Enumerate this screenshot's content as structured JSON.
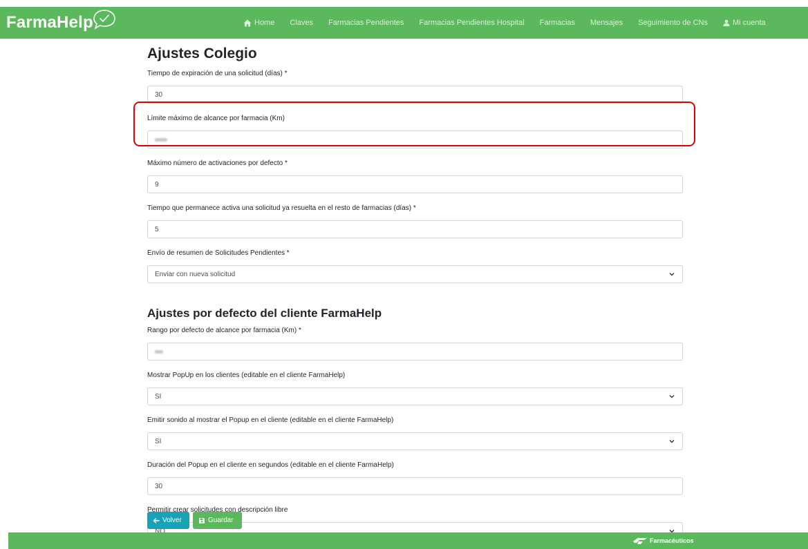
{
  "brand": {
    "name": "FarmaHelp"
  },
  "nav": {
    "home": "Home",
    "claves": "Claves",
    "farmacias_pendientes": "Farmacias Pendientes",
    "farmacias_pendientes_hospital": "Farmacias Pendientes Hospital",
    "farmacias": "Farmacias",
    "mensajes": "Mensajes",
    "seguimiento": "Seguimiento de CNs",
    "mi_cuenta": "Mi cuenta"
  },
  "colegio": {
    "title": "Ajustes Colegio",
    "expiracion_label": "Tiempo de expiración de una solicitud (días) *",
    "expiracion_value": "30",
    "alcance_label": "Límite máximo de alcance por farmacia (Km)",
    "activaciones_label": "Máximo número de activaciones por defecto *",
    "activaciones_value": "9",
    "permanece_label": "Tiempo que permanece activa una solicitud ya resuelta en el resto de farmacias (días) *",
    "permanece_value": "5",
    "resumen_label": "Envío de resumen de Solicitudes Pendientes *",
    "resumen_value": "Enviar con nueva solicitud"
  },
  "cliente": {
    "title": "Ajustes por defecto del cliente FarmaHelp",
    "rango_label": "Rango por defecto de alcance por farmacia (Km) *",
    "popup_label": "Mostrar PopUp en los clientes (editable en el cliente FarmaHelp)",
    "popup_value": "SI",
    "sonido_label": "Emitir sonido al mostrar el Popup en el cliente (editable en el cliente FarmaHelp)",
    "sonido_value": "SI",
    "duracion_label": "Duración del Popup en el cliente en segundos (editable en el cliente FarmaHelp)",
    "duracion_value": "30",
    "libre_label": "Permitir crear solicitudes con descripción libre",
    "libre_value": "NO"
  },
  "buttons": {
    "volver": "Volver",
    "guardar": "Guardar"
  },
  "footer": {
    "logo_text": "Farmacéuticos"
  },
  "colors": {
    "primary": "#5cb85c",
    "info": "#17a2b8",
    "highlight": "#e00000"
  }
}
